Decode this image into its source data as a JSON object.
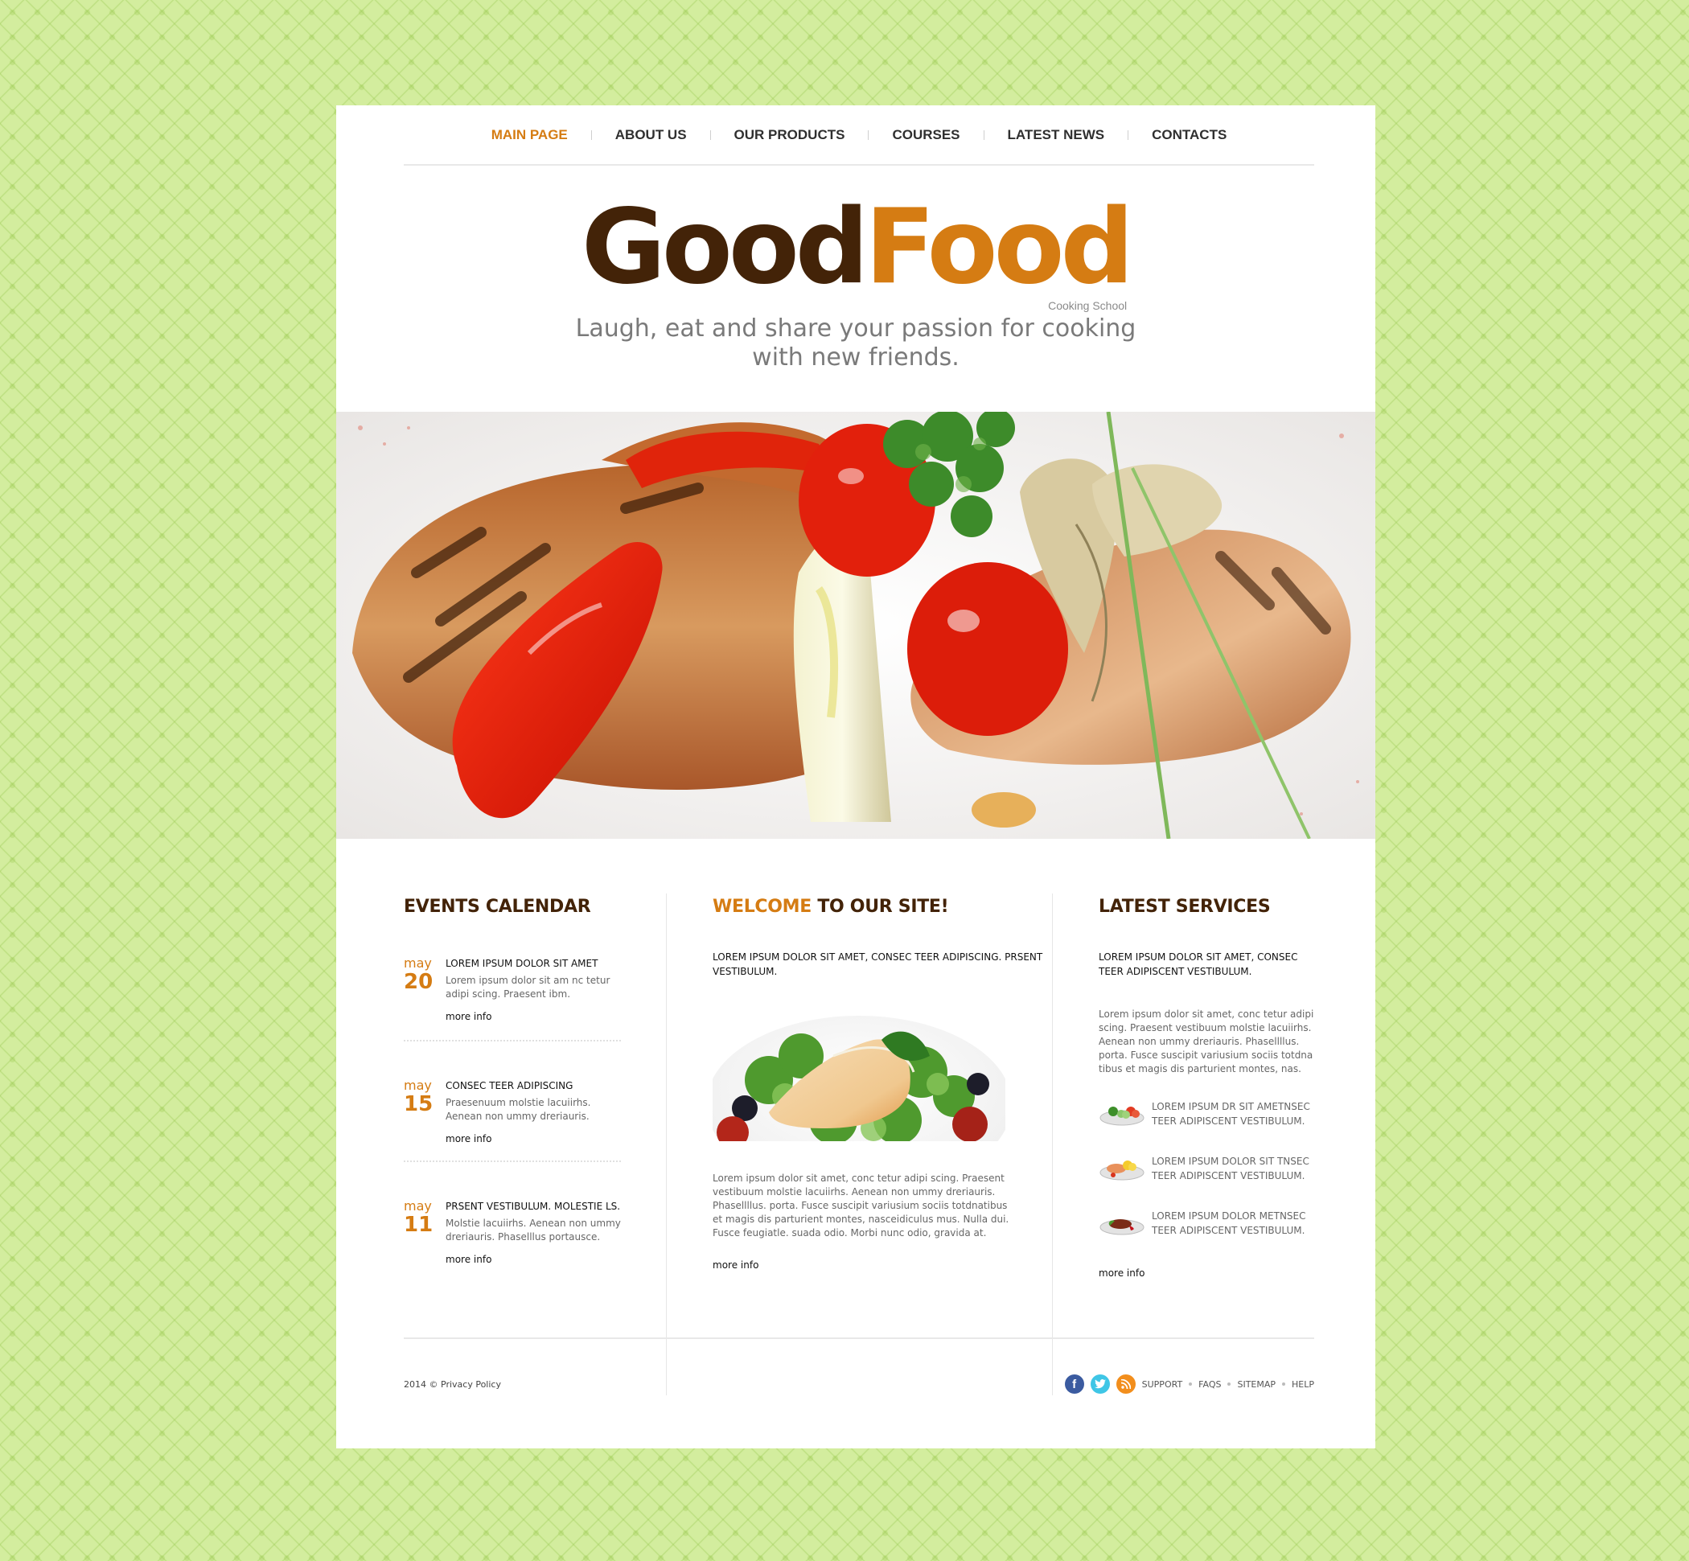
{
  "nav": {
    "items": [
      {
        "label": "MAIN PAGE",
        "active": true
      },
      {
        "label": "ABOUT US",
        "active": false
      },
      {
        "label": "OUR PRODUCTS",
        "active": false
      },
      {
        "label": "COURSES",
        "active": false
      },
      {
        "label": "LATEST NEWS",
        "active": false
      },
      {
        "label": "CONTACTS",
        "active": false
      }
    ]
  },
  "logo": {
    "part1": "Good",
    "part2": "Food",
    "subtitle": "Cooking School"
  },
  "tagline": {
    "line1": "Laugh, eat and share your passion for cooking",
    "line2": "with new friends."
  },
  "hero": {
    "image": "grilled-chicken-with-vegetables-photo"
  },
  "colors": {
    "accent": "#d57c13",
    "brown": "#432308",
    "background": "#d3ed9e"
  },
  "events": {
    "title": "EVENTS CALENDAR",
    "items": [
      {
        "month": "may",
        "day": "20",
        "title": "LOREM IPSUM DOLOR SIT AMET",
        "text": "Lorem ipsum dolor sit am nc tetur adipi scing. Praesent ibm.",
        "link": "more info"
      },
      {
        "month": "may",
        "day": "15",
        "title": "CONSEC TEER ADIPISCING",
        "text": "Praesenuum  molstie lacuiirhs. Aenean non ummy dreriauris.",
        "link": "more info"
      },
      {
        "month": "may",
        "day": "11",
        "title": "PRSENT VESTIBULUM.  MOLESTIE LS.",
        "text": "Molstie lacuiirhs. Aenean non ummy dreriauris. Phaselllus portausce.",
        "link": "more info"
      }
    ]
  },
  "welcome": {
    "title_accent": "WELCOME",
    "title_rest": " TO OUR SITE!",
    "lead": "LOREM IPSUM DOLOR SIT AMET, CONSEC TEER ADIPISCING. PRSENT VESTIBULUM.",
    "image": "grilled-fish-salad-photo",
    "body": "Lorem ipsum dolor sit amet, conc tetur adipi scing. Praesent vestibuum molstie lacuiirhs. Aenean non ummy dreriauris. Phasellllus. porta. Fusce suscipit variusium sociis totdnatibus et magis dis parturient montes, nasceidiculus mus. Nulla dui. Fusce feugiatle. suada odio. Morbi nunc odio, gravida at.",
    "link": "more info"
  },
  "services": {
    "title": "LATEST SERVICES",
    "lead": "LOREM IPSUM DOLOR SIT AMET, CONSEC TEER ADIPISCENT VESTIBULUM.",
    "body": "Lorem ipsum dolor sit amet, conc tetur adipi scing. Praesent vestibuum molstie lacuiirhs. Aenean non ummy dreriauris. Phasellllus. porta. Fusce suscipit variusium sociis totdna tibus et magis dis parturient montes, nas.",
    "items": [
      {
        "icon": "salad-plate-icon",
        "text": "LOREM IPSUM DR SIT AMETNSEC TEER ADIPISCENT VESTIBULUM."
      },
      {
        "icon": "salmon-plate-icon",
        "text": "LOREM IPSUM DOLOR SIT TNSEC TEER ADIPISCENT VESTIBULUM."
      },
      {
        "icon": "steak-plate-icon",
        "text": "LOREM IPSUM DOLOR METNSEC TEER ADIPISCENT VESTIBULUM."
      }
    ],
    "link": "more info"
  },
  "footer": {
    "year": "2014",
    "copyright_symbol": "©",
    "privacy": "Privacy Policy",
    "social": [
      {
        "name": "facebook-icon",
        "glyph": "f"
      },
      {
        "name": "twitter-icon",
        "glyph": "🐦"
      },
      {
        "name": "rss-icon",
        "glyph": "◉"
      }
    ],
    "links": [
      "SUPPORT",
      "FAQS",
      "SITEMAP",
      "HELP"
    ]
  }
}
